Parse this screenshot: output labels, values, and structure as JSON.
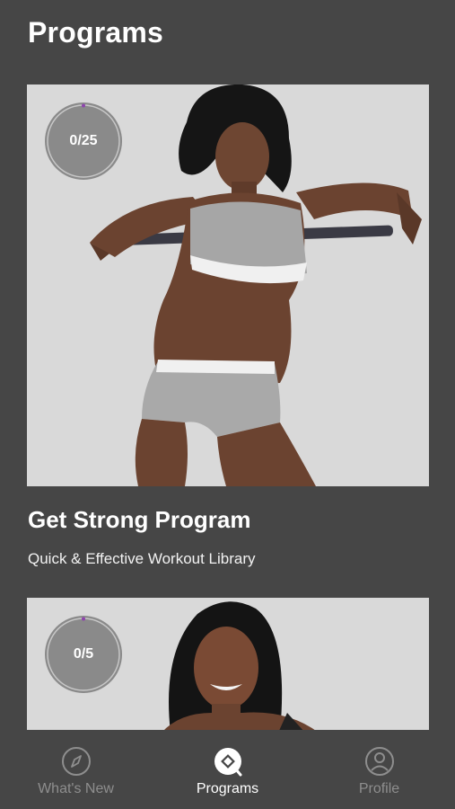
{
  "header": {
    "title": "Programs"
  },
  "programs": [
    {
      "progress_label": "0/25",
      "progress_fraction": 0,
      "title": "Get Strong Program",
      "subtitle": "Quick & Effective Workout Library",
      "image_description": "fitness-model-photo"
    },
    {
      "progress_label": "0/5",
      "progress_fraction": 0,
      "image_description": "fitness-model-photo"
    }
  ],
  "nav": {
    "items": [
      {
        "label": "What's New",
        "icon": "compass-icon",
        "active": false
      },
      {
        "label": "Programs",
        "icon": "programs-pin-icon",
        "active": true
      },
      {
        "label": "Profile",
        "icon": "profile-icon",
        "active": false
      }
    ]
  },
  "colors": {
    "background": "#464646",
    "card_background": "#d9d9d9",
    "ring_fill": "#8a8a8a",
    "ring_accent": "#8e44ad",
    "nav_inactive": "#8e8e8e",
    "nav_active": "#ffffff"
  }
}
